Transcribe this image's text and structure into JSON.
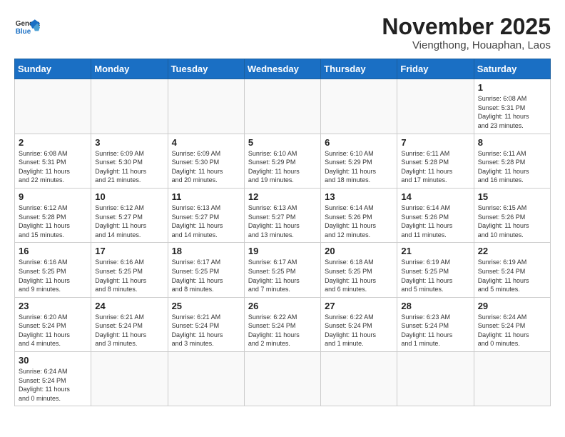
{
  "header": {
    "logo_general": "General",
    "logo_blue": "Blue",
    "month_title": "November 2025",
    "location": "Viengthong, Houaphan, Laos"
  },
  "weekdays": [
    "Sunday",
    "Monday",
    "Tuesday",
    "Wednesday",
    "Thursday",
    "Friday",
    "Saturday"
  ],
  "weeks": [
    [
      {
        "day": "",
        "info": ""
      },
      {
        "day": "",
        "info": ""
      },
      {
        "day": "",
        "info": ""
      },
      {
        "day": "",
        "info": ""
      },
      {
        "day": "",
        "info": ""
      },
      {
        "day": "",
        "info": ""
      },
      {
        "day": "1",
        "info": "Sunrise: 6:08 AM\nSunset: 5:31 PM\nDaylight: 11 hours\nand 23 minutes."
      }
    ],
    [
      {
        "day": "2",
        "info": "Sunrise: 6:08 AM\nSunset: 5:31 PM\nDaylight: 11 hours\nand 22 minutes."
      },
      {
        "day": "3",
        "info": "Sunrise: 6:09 AM\nSunset: 5:30 PM\nDaylight: 11 hours\nand 21 minutes."
      },
      {
        "day": "4",
        "info": "Sunrise: 6:09 AM\nSunset: 5:30 PM\nDaylight: 11 hours\nand 20 minutes."
      },
      {
        "day": "5",
        "info": "Sunrise: 6:10 AM\nSunset: 5:29 PM\nDaylight: 11 hours\nand 19 minutes."
      },
      {
        "day": "6",
        "info": "Sunrise: 6:10 AM\nSunset: 5:29 PM\nDaylight: 11 hours\nand 18 minutes."
      },
      {
        "day": "7",
        "info": "Sunrise: 6:11 AM\nSunset: 5:28 PM\nDaylight: 11 hours\nand 17 minutes."
      },
      {
        "day": "8",
        "info": "Sunrise: 6:11 AM\nSunset: 5:28 PM\nDaylight: 11 hours\nand 16 minutes."
      }
    ],
    [
      {
        "day": "9",
        "info": "Sunrise: 6:12 AM\nSunset: 5:28 PM\nDaylight: 11 hours\nand 15 minutes."
      },
      {
        "day": "10",
        "info": "Sunrise: 6:12 AM\nSunset: 5:27 PM\nDaylight: 11 hours\nand 14 minutes."
      },
      {
        "day": "11",
        "info": "Sunrise: 6:13 AM\nSunset: 5:27 PM\nDaylight: 11 hours\nand 14 minutes."
      },
      {
        "day": "12",
        "info": "Sunrise: 6:13 AM\nSunset: 5:27 PM\nDaylight: 11 hours\nand 13 minutes."
      },
      {
        "day": "13",
        "info": "Sunrise: 6:14 AM\nSunset: 5:26 PM\nDaylight: 11 hours\nand 12 minutes."
      },
      {
        "day": "14",
        "info": "Sunrise: 6:14 AM\nSunset: 5:26 PM\nDaylight: 11 hours\nand 11 minutes."
      },
      {
        "day": "15",
        "info": "Sunrise: 6:15 AM\nSunset: 5:26 PM\nDaylight: 11 hours\nand 10 minutes."
      }
    ],
    [
      {
        "day": "16",
        "info": "Sunrise: 6:16 AM\nSunset: 5:25 PM\nDaylight: 11 hours\nand 9 minutes."
      },
      {
        "day": "17",
        "info": "Sunrise: 6:16 AM\nSunset: 5:25 PM\nDaylight: 11 hours\nand 8 minutes."
      },
      {
        "day": "18",
        "info": "Sunrise: 6:17 AM\nSunset: 5:25 PM\nDaylight: 11 hours\nand 8 minutes."
      },
      {
        "day": "19",
        "info": "Sunrise: 6:17 AM\nSunset: 5:25 PM\nDaylight: 11 hours\nand 7 minutes."
      },
      {
        "day": "20",
        "info": "Sunrise: 6:18 AM\nSunset: 5:25 PM\nDaylight: 11 hours\nand 6 minutes."
      },
      {
        "day": "21",
        "info": "Sunrise: 6:19 AM\nSunset: 5:25 PM\nDaylight: 11 hours\nand 5 minutes."
      },
      {
        "day": "22",
        "info": "Sunrise: 6:19 AM\nSunset: 5:24 PM\nDaylight: 11 hours\nand 5 minutes."
      }
    ],
    [
      {
        "day": "23",
        "info": "Sunrise: 6:20 AM\nSunset: 5:24 PM\nDaylight: 11 hours\nand 4 minutes."
      },
      {
        "day": "24",
        "info": "Sunrise: 6:21 AM\nSunset: 5:24 PM\nDaylight: 11 hours\nand 3 minutes."
      },
      {
        "day": "25",
        "info": "Sunrise: 6:21 AM\nSunset: 5:24 PM\nDaylight: 11 hours\nand 3 minutes."
      },
      {
        "day": "26",
        "info": "Sunrise: 6:22 AM\nSunset: 5:24 PM\nDaylight: 11 hours\nand 2 minutes."
      },
      {
        "day": "27",
        "info": "Sunrise: 6:22 AM\nSunset: 5:24 PM\nDaylight: 11 hours\nand 1 minute."
      },
      {
        "day": "28",
        "info": "Sunrise: 6:23 AM\nSunset: 5:24 PM\nDaylight: 11 hours\nand 1 minute."
      },
      {
        "day": "29",
        "info": "Sunrise: 6:24 AM\nSunset: 5:24 PM\nDaylight: 11 hours\nand 0 minutes."
      }
    ],
    [
      {
        "day": "30",
        "info": "Sunrise: 6:24 AM\nSunset: 5:24 PM\nDaylight: 11 hours\nand 0 minutes."
      },
      {
        "day": "",
        "info": ""
      },
      {
        "day": "",
        "info": ""
      },
      {
        "day": "",
        "info": ""
      },
      {
        "day": "",
        "info": ""
      },
      {
        "day": "",
        "info": ""
      },
      {
        "day": "",
        "info": ""
      }
    ]
  ],
  "colors": {
    "header_bg": "#1a6fc4",
    "logo_blue": "#1a6fc4"
  }
}
